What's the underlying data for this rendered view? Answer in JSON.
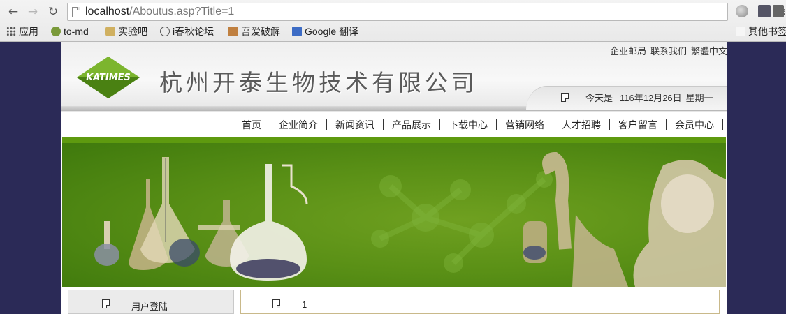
{
  "browser": {
    "url_host": "localhost",
    "url_path": "/Aboutus.asp?Title=1",
    "bookmarks": [
      {
        "label": "应用",
        "icon": "apps-grid-icon"
      },
      {
        "label": "to-md",
        "icon": "leaf-icon"
      },
      {
        "label": "实验吧",
        "icon": "lab-icon"
      },
      {
        "label": "i春秋论坛",
        "icon": "i-icon"
      },
      {
        "label": "吾爱破解",
        "icon": "image-icon"
      },
      {
        "label": "Google 翻译",
        "icon": "translate-icon"
      }
    ],
    "other_bookmarks": "其他书签"
  },
  "header": {
    "company_name": "杭州开泰生物技术有限公司",
    "logo_text": "KATIMES",
    "top_links": [
      "企业邮局",
      "联系我们",
      "繁體中文"
    ],
    "date_label": "今天是",
    "date_value": "116年12月26日",
    "weekday": "星期一"
  },
  "nav": {
    "items": [
      "首页",
      "企业简介",
      "新闻资讯",
      "产品展示",
      "下载中心",
      "营销网络",
      "人才招聘",
      "客户留言",
      "会员中心"
    ]
  },
  "sidebar": {
    "title": "用户登陆"
  },
  "content": {
    "title": "1"
  },
  "colors": {
    "page_bg": "#2b2a57",
    "banner_green": "#5a9016",
    "logo_green": "#5e9a1b"
  }
}
